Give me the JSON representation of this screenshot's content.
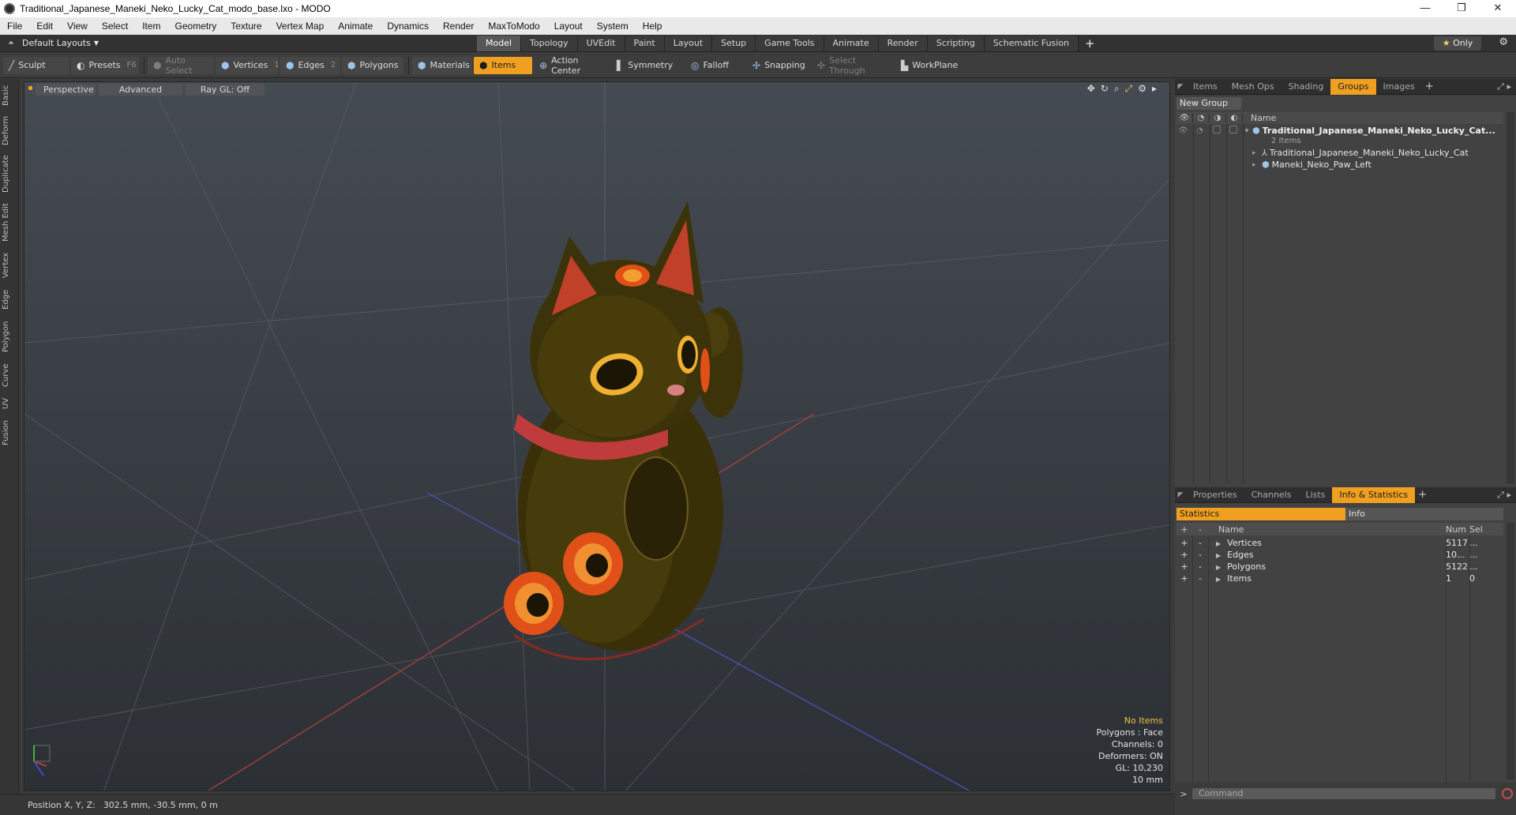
{
  "window": {
    "title": "Traditional_Japanese_Maneki_Neko_Lucky_Cat_modo_base.lxo - MODO",
    "minimize": "—",
    "maximize": "❐",
    "close": "✕"
  },
  "menu": [
    "File",
    "Edit",
    "View",
    "Select",
    "Item",
    "Geometry",
    "Texture",
    "Vertex Map",
    "Animate",
    "Dynamics",
    "Render",
    "MaxToModo",
    "Layout",
    "System",
    "Help"
  ],
  "layout": {
    "dropdown": "Default Layouts",
    "tabs": [
      "Model",
      "Topology",
      "UVEdit",
      "Paint",
      "Layout",
      "Setup",
      "Game Tools",
      "Animate",
      "Render",
      "Scripting",
      "Schematic Fusion"
    ],
    "active_tab": "Model",
    "only": "Only"
  },
  "toolbar": {
    "sculpt": "Sculpt",
    "presets": "Presets",
    "presets_key": "F6",
    "auto_select": "Auto Select",
    "vertices": "Vertices",
    "vertices_num": "1",
    "edges": "Edges",
    "edges_num": "2",
    "polygons": "Polygons",
    "materials": "Materials",
    "items": "Items",
    "action_center": "Action Center",
    "symmetry": "Symmetry",
    "falloff": "Falloff",
    "snapping": "Snapping",
    "select_through": "Select Through",
    "workplane": "WorkPlane"
  },
  "left_tabs": [
    "Basic",
    "Deform",
    "Duplicate",
    "Mesh Edit",
    "Vertex",
    "Edge",
    "Polygon",
    "Curve",
    "UV",
    "Fusion"
  ],
  "viewport": {
    "view": "Perspective",
    "shading": "Advanced",
    "raygl": "Ray GL: Off",
    "info": {
      "selection": "No Items",
      "polygons": "Polygons : Face",
      "channels": "Channels: 0",
      "deformers": "Deformers: ON",
      "gl": "GL: 10,230",
      "scale": "10 mm"
    }
  },
  "groups_panel": {
    "tabs": [
      "Items",
      "Mesh Ops",
      "Shading",
      "Groups",
      "Images"
    ],
    "active_tab": "Groups",
    "new_group": "New Group",
    "name_header": "Name",
    "rows": [
      {
        "name": "Traditional_Japanese_Maneki_Neko_Lucky_Cat...",
        "sub": "2 Items"
      },
      {
        "name": "Traditional_Japanese_Maneki_Neko_Lucky_Cat"
      },
      {
        "name": "Maneki_Neko_Paw_Left"
      }
    ]
  },
  "stats_panel": {
    "tabs": [
      "Properties",
      "Channels",
      "Lists",
      "Info & Statistics"
    ],
    "active_tab": "Info & Statistics",
    "subtabs": [
      "Statistics",
      "Info"
    ],
    "headers": {
      "name": "Name",
      "num": "Num",
      "sel": "Sel"
    },
    "rows": [
      {
        "name": "Vertices",
        "num": "5117",
        "sel": "..."
      },
      {
        "name": "Edges",
        "num": "10...",
        "sel": "..."
      },
      {
        "name": "Polygons",
        "num": "5122",
        "sel": "..."
      },
      {
        "name": "Items",
        "num": "1",
        "sel": "0"
      }
    ]
  },
  "command": {
    "prompt": ">",
    "placeholder": "Command"
  },
  "status": {
    "label": "Position X, Y, Z:",
    "value": "302.5 mm, -30.5 mm, 0 m"
  },
  "colors": {
    "accent": "#f0a020",
    "x_axis": "#d04040",
    "z_axis": "#4050c0"
  }
}
